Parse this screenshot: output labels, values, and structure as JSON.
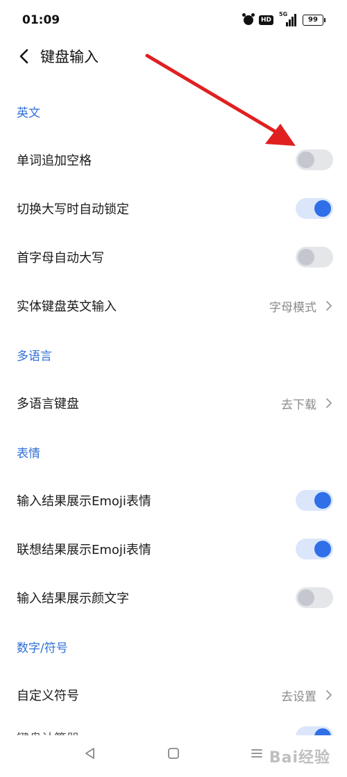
{
  "status_bar": {
    "time": "01:09",
    "network": "5G",
    "battery": "99",
    "icons": [
      "alarm-icon",
      "hd-icon",
      "signal-icon",
      "battery-icon"
    ]
  },
  "header": {
    "title": "键盘输入",
    "back_icon": "chevron-left-icon"
  },
  "sections": [
    {
      "title": "英文",
      "rows": [
        {
          "label": "单词追加空格",
          "type": "toggle",
          "on": false
        },
        {
          "label": "切换大写时自动锁定",
          "type": "toggle",
          "on": true
        },
        {
          "label": "首字母自动大写",
          "type": "toggle",
          "on": false
        },
        {
          "label": "实体键盘英文输入",
          "type": "link",
          "value": "字母模式"
        }
      ]
    },
    {
      "title": "多语言",
      "rows": [
        {
          "label": "多语言键盘",
          "type": "link",
          "value": "去下载"
        }
      ]
    },
    {
      "title": "表情",
      "rows": [
        {
          "label": "输入结果展示Emoji表情",
          "type": "toggle",
          "on": true
        },
        {
          "label": "联想结果展示Emoji表情",
          "type": "toggle",
          "on": true
        },
        {
          "label": "输入结果展示颜文字",
          "type": "toggle",
          "on": false
        }
      ]
    },
    {
      "title": "数字/符号",
      "rows": [
        {
          "label": "自定义符号",
          "type": "link",
          "value": "去设置"
        },
        {
          "label": "键盘计算器",
          "type": "toggle",
          "on": true,
          "partial": true
        }
      ]
    }
  ],
  "nav_bar": {
    "icons": [
      "back-triangle-icon",
      "home-square-icon",
      "menu-lines-icon"
    ]
  },
  "colors": {
    "accent": "#2f6fe8",
    "section_header": "#2f6fd6",
    "annotation_arrow": "#e02020"
  },
  "watermark": "Bai经验"
}
